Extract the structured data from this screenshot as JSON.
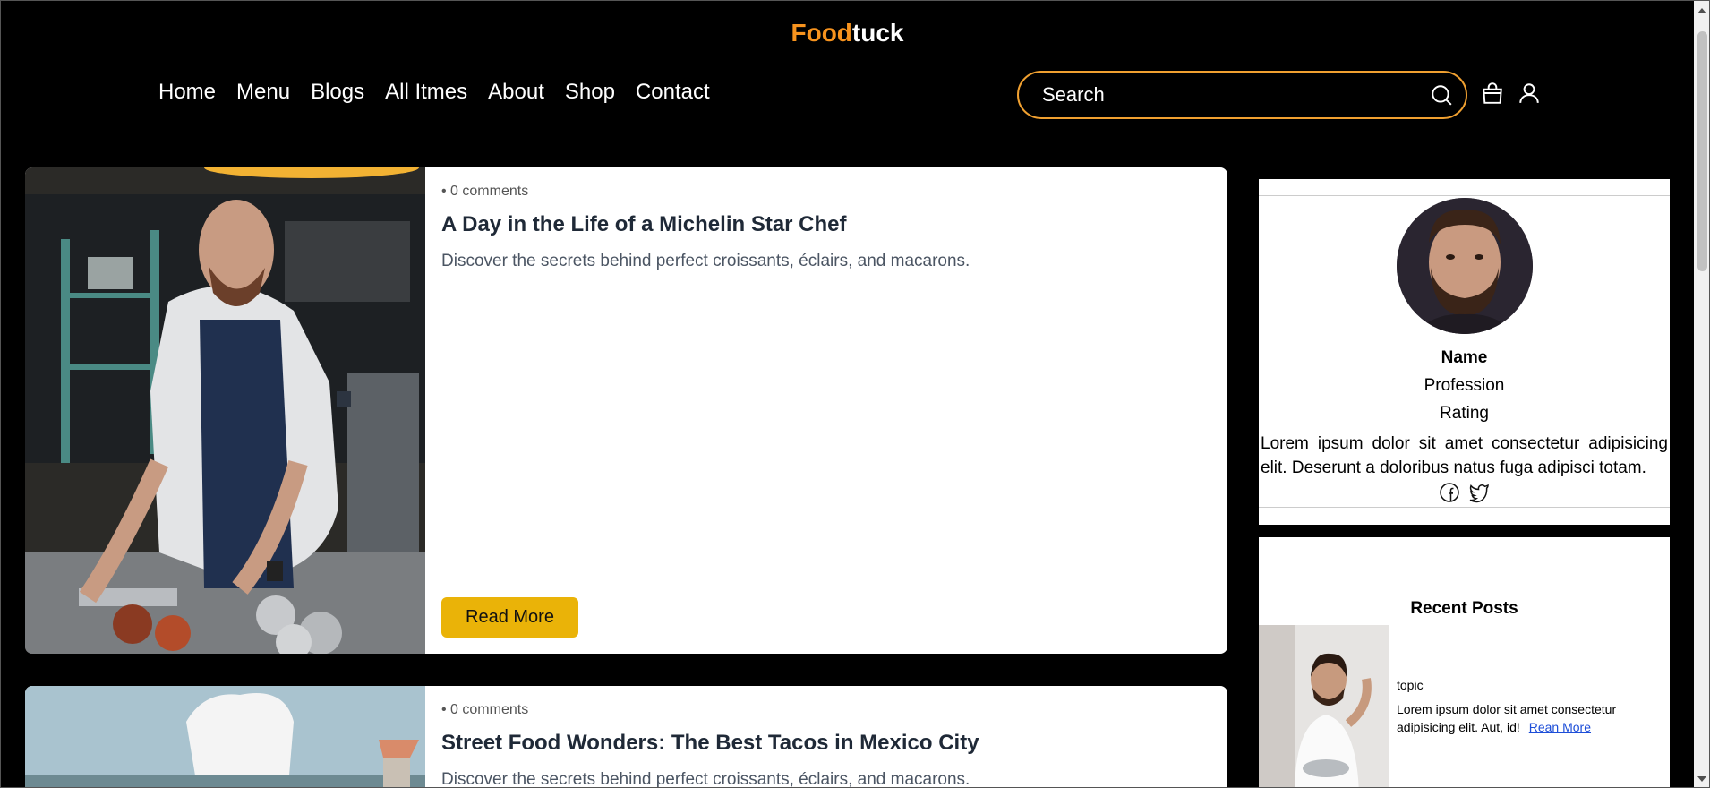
{
  "header": {
    "logo_part1": "Food",
    "logo_part2": "tuck",
    "nav": [
      "Home",
      "Menu",
      "Blogs",
      "All Itmes",
      "About",
      "Shop",
      "Contact"
    ],
    "search_placeholder": "Search",
    "icons": [
      "search-icon",
      "shopping-bag-icon",
      "user-icon"
    ]
  },
  "posts": [
    {
      "comments": "• 0 comments",
      "title": "A Day in the Life of a Michelin Star Chef",
      "description": "Discover the secrets behind perfect croissants, éclairs, and macarons.",
      "button": "Read More"
    },
    {
      "comments": "• 0 comments",
      "title": "Street Food Wonders: The Best Tacos in Mexico City",
      "description": "Discover the secrets behind perfect croissants, éclairs, and macarons."
    }
  ],
  "profile": {
    "name": "Name",
    "profession": "Profession",
    "rating": "Rating",
    "bio": "Lorem ipsum dolor sit amet consectetur adipisicing elit. Deserunt a doloribus natus fuga adipisci totam.",
    "socials": [
      "facebook-icon",
      "twitter-icon"
    ]
  },
  "recent_posts": {
    "title": "Recent Posts",
    "items": [
      {
        "topic": "topic",
        "text": "Lorem ipsum dolor sit amet consectetur adipisicing elit. Aut, id!",
        "link": "Rean More"
      }
    ]
  },
  "colors": {
    "accent_orange": "#f7931e",
    "search_border": "#f0a030",
    "button_yellow": "#eab308",
    "background": "#000000"
  }
}
